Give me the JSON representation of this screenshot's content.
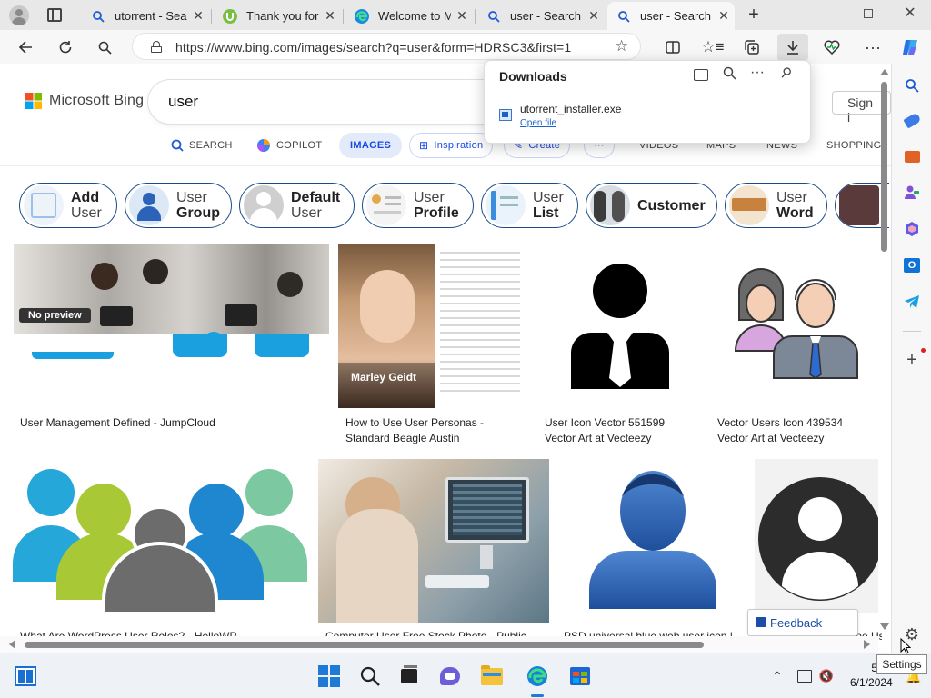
{
  "tabs": [
    {
      "title": "utorrent - Sear",
      "icon": "bing-search-icon"
    },
    {
      "title": "Thank you for",
      "icon": "utorrent-icon"
    },
    {
      "title": "Welcome to M",
      "icon": "edge-icon"
    },
    {
      "title": "user - Search",
      "icon": "bing-search-icon"
    },
    {
      "title": "user - Search I",
      "icon": "bing-search-icon",
      "active": true
    }
  ],
  "address": {
    "url": "https://www.bing.com/images/search?q=user&form=HDRSC3&first=1"
  },
  "bing": {
    "logo_text": "Microsoft Bing",
    "query": "user",
    "signin_label": "Sign i",
    "scopes": [
      "SEARCH",
      "COPILOT",
      "IMAGES",
      "Inspiration",
      "Create",
      "···",
      "VIDEOS",
      "MAPS",
      "NEWS",
      "SHOPPING"
    ]
  },
  "chips": [
    {
      "line1": "Add",
      "line2": "User",
      "bold": 1
    },
    {
      "line1": "User",
      "line2": "Group",
      "bold": 2
    },
    {
      "line1": "Default",
      "line2": "User",
      "bold": 1
    },
    {
      "line1": "User",
      "line2": "Profile",
      "bold": 2
    },
    {
      "line1": "User",
      "line2": "List",
      "bold": 2
    },
    {
      "line1": "Customer",
      "line2": "",
      "bold": 1
    },
    {
      "line1": "User",
      "line2": "Word",
      "bold": 2
    }
  ],
  "results": [
    {
      "caption": "User Management Defined - JumpCloud",
      "badge": "No preview"
    },
    {
      "caption": "How to Use User Personas - Standard Beagle Austin",
      "overlay_name": "Marley Geidt"
    },
    {
      "caption": "User Icon Vector 551599 Vector Art at Vecteezy"
    },
    {
      "caption": "Vector Users Icon 439534 Vector Art at Vecteezy"
    },
    {
      "caption": "What Are WordPress User Roles? - HelloWP"
    },
    {
      "caption": "Computer User Free Stock Photo - Public"
    },
    {
      "caption": "PSD universal blue web user icon |"
    },
    {
      "caption": "Free User Ic"
    }
  ],
  "downloads": {
    "title": "Downloads",
    "file_name": "utorrent_installer.exe",
    "action": "Open file"
  },
  "feedback_label": "Feedback",
  "taskbar": {
    "time": "5:52",
    "date": "6/1/2024"
  },
  "tooltip": "Settings"
}
